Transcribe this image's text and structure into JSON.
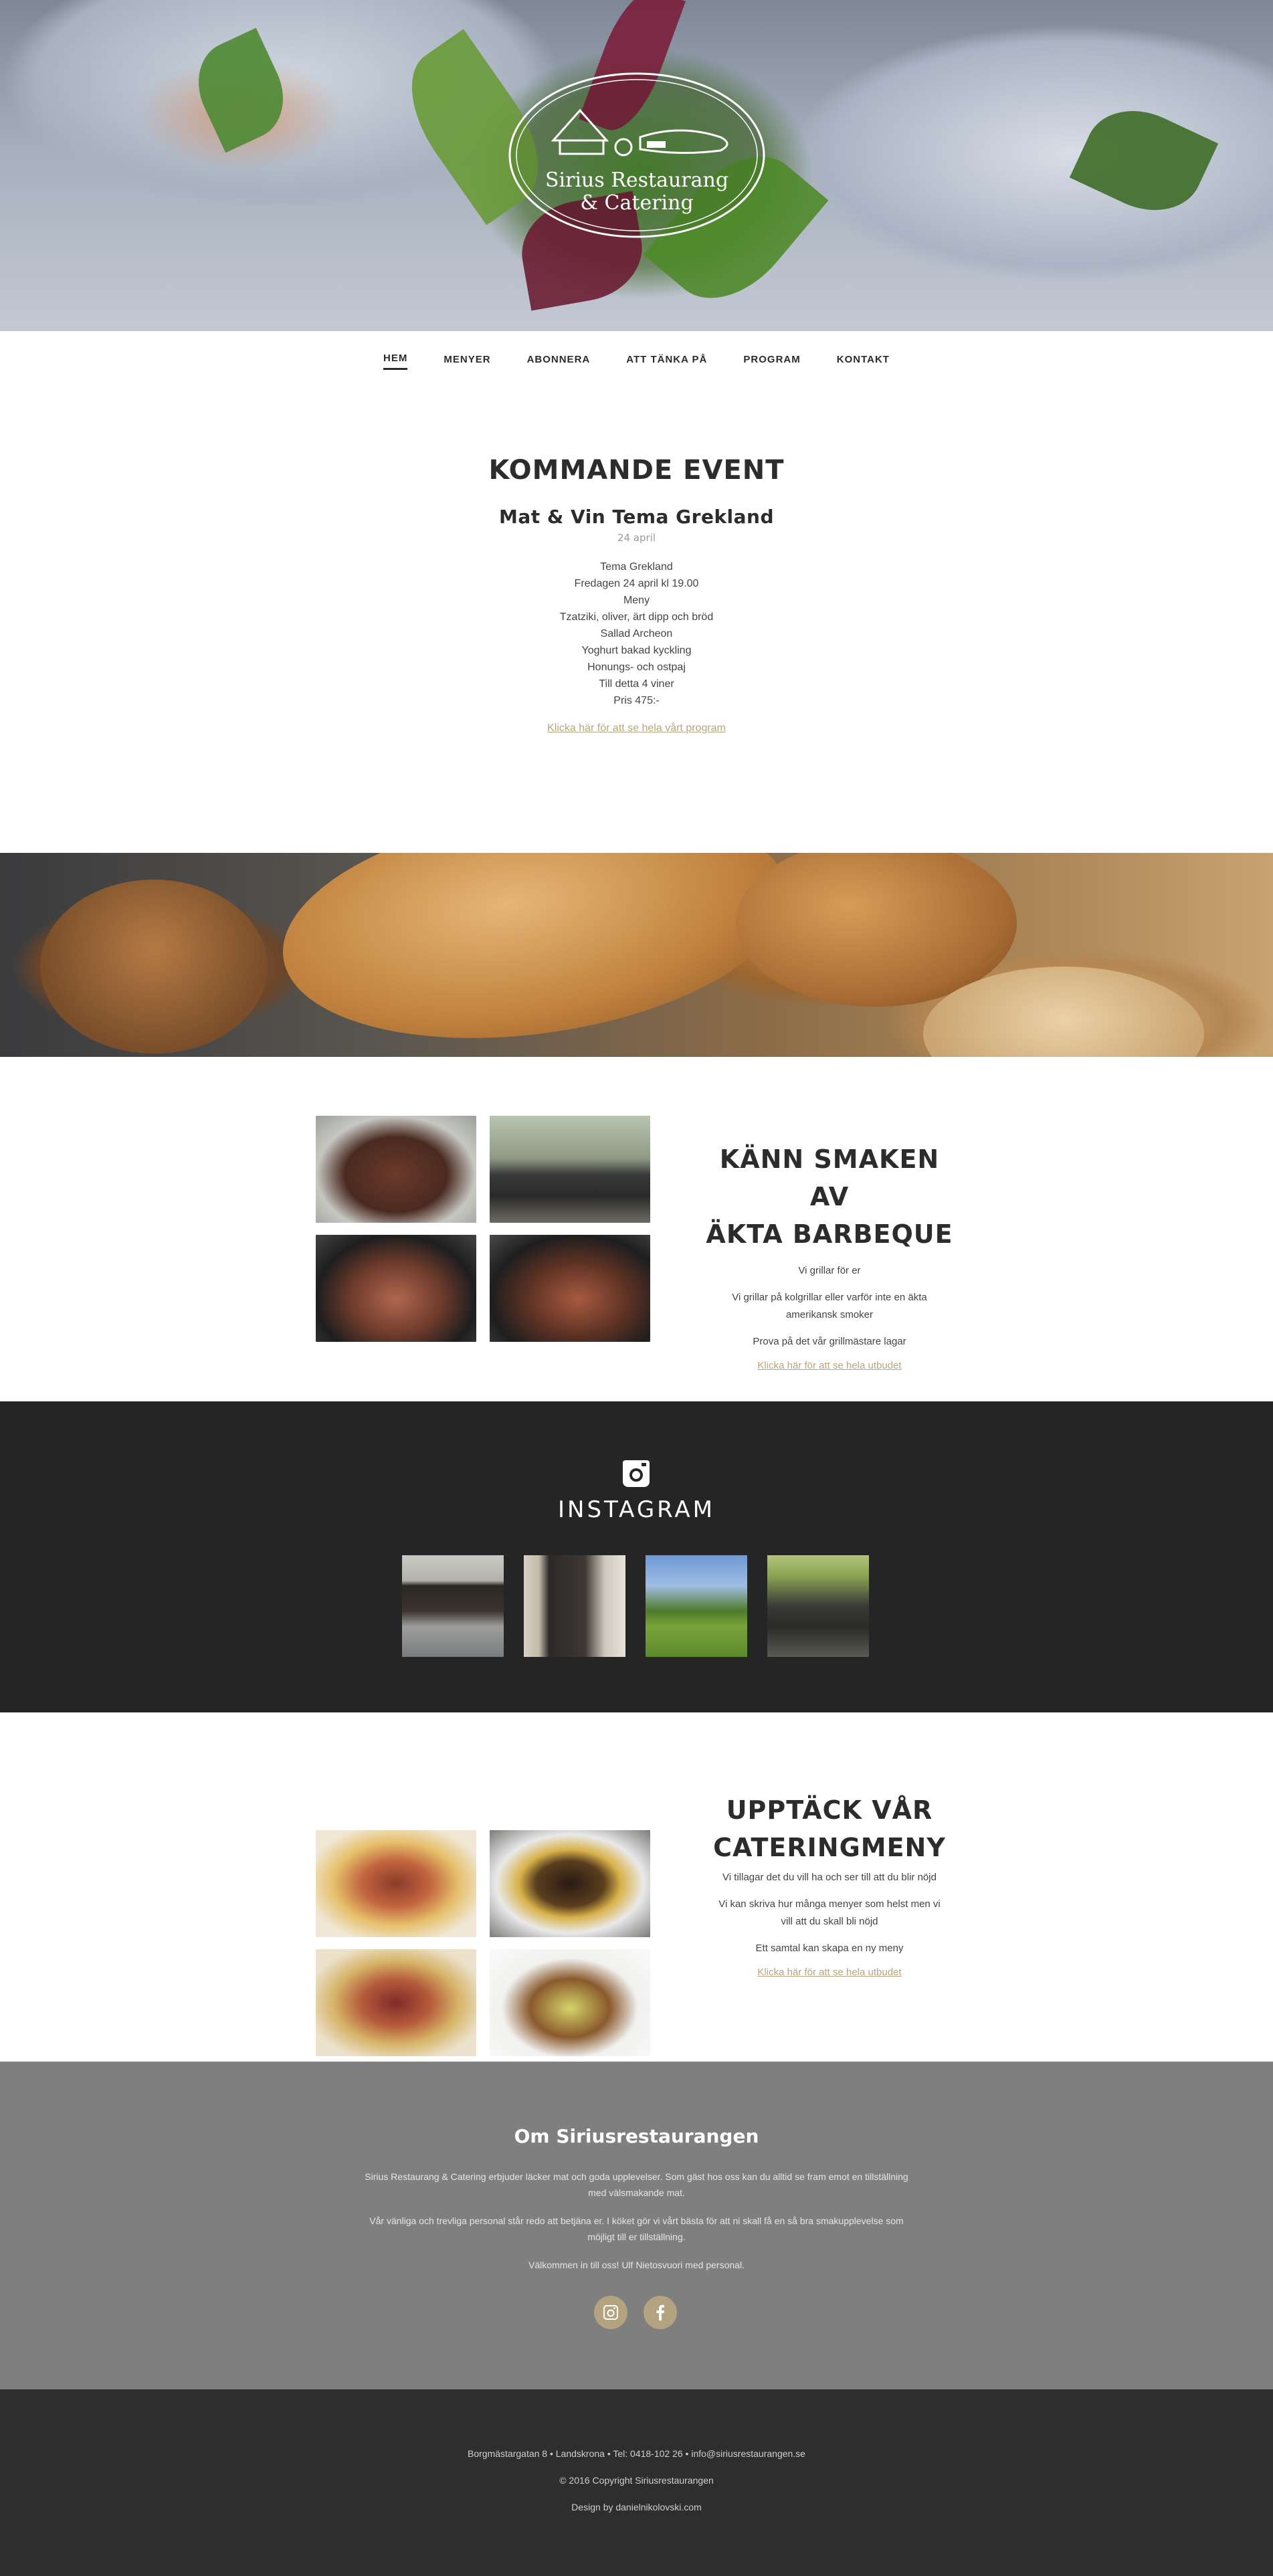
{
  "brand": {
    "logo_line1": "Sirius Restaurang",
    "logo_line2": "& Catering"
  },
  "nav": {
    "items": [
      {
        "label": "HEM",
        "active": true
      },
      {
        "label": "MENYER"
      },
      {
        "label": "ABONNERA"
      },
      {
        "label": "ATT TÄNKA PÅ"
      },
      {
        "label": "PROGRAM"
      },
      {
        "label": "KONTAKT"
      }
    ]
  },
  "event": {
    "heading": "KOMMANDE EVENT",
    "title": "Mat & Vin Tema Grekland",
    "date": "24 april",
    "lines": [
      "Tema Grekland",
      "Fredagen 24 april kl 19.00",
      "Meny",
      "Tzatziki, oliver, ärt dipp och bröd",
      "Sallad Archeon",
      "Yoghurt bakad kyckling",
      "Honungs- och ostpaj",
      "Till detta 4 viner",
      "Pris 475:-"
    ],
    "link": "Klicka här för att se hela vårt program"
  },
  "bbq": {
    "heading_line1": "KÄNN SMAKEN AV",
    "heading_line2": "ÄKTA BARBEQUE",
    "p1": "Vi grillar för er",
    "p2_line1": "Vi grillar på kolgrillar eller varför inte en äkta",
    "p2_line2": "amerikansk smoker",
    "p3": "Prova på det vår grillmästare lagar",
    "link": "Klicka här för att se hela utbudet"
  },
  "instagram": {
    "heading": "INSTAGRAM"
  },
  "catering": {
    "heading_line1": "UPPTÄCK VÅR",
    "heading_line2": "CATERINGMENY",
    "p1": "Vi tillagar det du vill ha och ser till att du blir nöjd",
    "p2_line1": "Vi kan skriva hur många menyer som helst men vi",
    "p2_line2": "vill att du skall bli nöjd",
    "p3": "Ett samtal kan skapa en ny meny",
    "link": "Klicka här för att se hela utbudet"
  },
  "about": {
    "heading": "Om Siriusrestaurangen",
    "p1_line1": "Sirius Restaurang & Catering erbjuder läcker mat och goda upplevelser. Som gäst hos oss kan du alltid se fram emot en tillställning",
    "p1_line2": "med välsmakande mat.",
    "p2_line1": "Vår vänliga och trevliga personal står redo att betjäna er. I köket gör vi vårt bästa för att ni skall få en så bra smakupplevelse som",
    "p2_line2": "möjligt till er tillställning.",
    "p3": "Välkommen in till oss! Ulf Nietosvuori med personal."
  },
  "footer": {
    "address": "Borgmästargatan 8  •  Landskrona  •  Tel: 0418-102 26  •  info@siriusrestaurangen.se",
    "copyright": "© 2016 Copyright Siriusrestaurangen",
    "design": "Design by danielnikolovski.com"
  },
  "icons": {
    "instagram": "instagram-icon",
    "facebook": "facebook-icon"
  },
  "colors": {
    "accent": "#b3a37f",
    "dark": "#252525",
    "about_bg": "#7f7f7f",
    "footer_bg": "#2e2e2e"
  }
}
